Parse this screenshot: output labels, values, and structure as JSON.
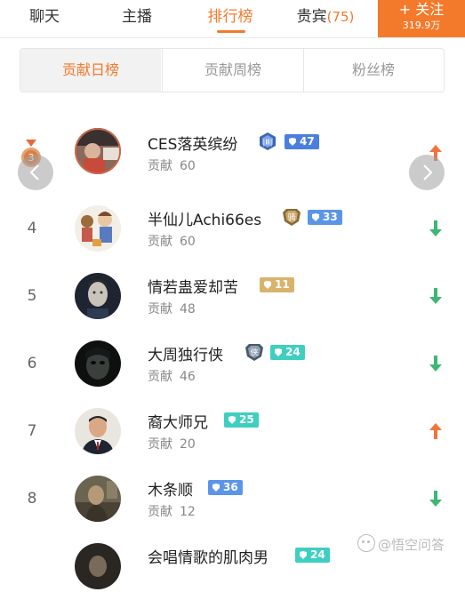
{
  "nav": {
    "tabs": [
      {
        "label": "聊天"
      },
      {
        "label": "主播"
      },
      {
        "label": "排行榜"
      },
      {
        "label": "贵宾",
        "count": "(75)"
      }
    ],
    "follow": {
      "label": "+ 关注",
      "count": "319.9万"
    }
  },
  "segments": [
    "贡献日榜",
    "贡献周榜",
    "粉丝榜"
  ],
  "rows": [
    {
      "rank": "",
      "name": "CES落英缤纷",
      "contrib_label": "贡献",
      "contrib": "60",
      "level": "47",
      "trend": "up",
      "badge": "blue-emblem-icon",
      "badge_text": "",
      "level_color": "#4a7fe0"
    },
    {
      "rank": "4",
      "name": "半仙儿Achi66es",
      "contrib_label": "贡献",
      "contrib": "60",
      "level": "33",
      "trend": "down",
      "badge": "knight-emblem-icon",
      "badge_text": "骑",
      "level_color": "#5b95e8"
    },
    {
      "rank": "5",
      "name": "情若蛊爱却苦",
      "contrib_label": "贡献",
      "contrib": "48",
      "level": "11",
      "trend": "down",
      "badge": "",
      "badge_text": "",
      "level_color": "#d9b36c"
    },
    {
      "rank": "6",
      "name": "大周独行侠",
      "contrib_label": "贡献",
      "contrib": "46",
      "level": "24",
      "trend": "down",
      "badge": "hero-emblem-icon",
      "badge_text": "侠",
      "level_color": "#3fcfc0"
    },
    {
      "rank": "7",
      "name": "裔大师兄",
      "contrib_label": "贡献",
      "contrib": "20",
      "level": "25",
      "trend": "up",
      "badge": "",
      "badge_text": "",
      "level_color": "#3fcfc0"
    },
    {
      "rank": "8",
      "name": "木条顺",
      "contrib_label": "贡献",
      "contrib": "12",
      "level": "36",
      "trend": "down",
      "badge": "",
      "badge_text": "",
      "level_color": "#5b95e8"
    },
    {
      "rank": "",
      "name": "会唱情歌的肌肉男",
      "contrib_label": "",
      "contrib": "",
      "level": "24",
      "trend": "down",
      "badge": "",
      "badge_text": "",
      "level_color": "#3fcfc0"
    }
  ],
  "watermark": "@悟空问答",
  "colors": {
    "accent": "#f47a2b",
    "up": "#f0743a",
    "down": "#3cb874"
  }
}
